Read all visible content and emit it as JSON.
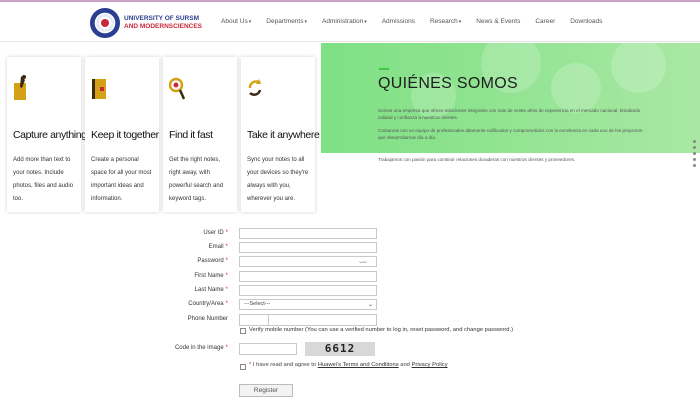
{
  "header": {
    "logo_line1": "UNIVERSITY OF SURSM",
    "logo_line2": "AND MODERNSCIENCES",
    "nav": [
      {
        "label": "About Us",
        "dropdown": true
      },
      {
        "label": "Departments",
        "dropdown": true
      },
      {
        "label": "Administration",
        "dropdown": true
      },
      {
        "label": "Admissions",
        "dropdown": false
      },
      {
        "label": "Research",
        "dropdown": true
      },
      {
        "label": "News & Events",
        "dropdown": false
      },
      {
        "label": "Career",
        "dropdown": false
      },
      {
        "label": "Downloads",
        "dropdown": false
      }
    ]
  },
  "cards": [
    {
      "icon": "pencil-icon",
      "title": "Capture anything",
      "desc": "Add more than text to your notes. Include photos, files and audio too."
    },
    {
      "icon": "notebook-icon",
      "title": "Keep it together",
      "desc": "Create a personal space for all your most important ideas and information."
    },
    {
      "icon": "magnifier-icon",
      "title": "Find it fast",
      "desc": "Get the right notes, right away, with powerful search and keyword tags."
    },
    {
      "icon": "sync-icon",
      "title": "Take it anywhere",
      "desc": "Sync your notes to all your devices so they're always with you, wherever you are."
    }
  ],
  "hero": {
    "title": "QUIÉNES SOMOS",
    "paragraphs": [
      "Somos una empresa que ofrece soluciones integrales con más de veinte años de experiencia en el mercado nacional, brindando calidad y confianza a nuestros clientes.",
      "Contamos con un equipo de profesionales altamente calificados y comprometidos con la excelencia en cada uno de los proyectos que desarrollamos día a día.",
      "Trabajamos con pasión para construir relaciones duraderas con nuestros clientes y proveedores."
    ]
  },
  "form": {
    "user_id": {
      "label": "User ID",
      "required": true,
      "value": ""
    },
    "email": {
      "label": "Email",
      "required": true,
      "value": ""
    },
    "password": {
      "label": "Password",
      "required": true,
      "value": ""
    },
    "first_name": {
      "label": "First Name",
      "required": true,
      "value": ""
    },
    "last_name": {
      "label": "Last Name",
      "required": true,
      "value": ""
    },
    "country": {
      "label": "Country/Area",
      "required": true,
      "selected": "---Select---"
    },
    "phone": {
      "label": "Phone Number",
      "required": false
    },
    "verify_text": "Verify mobile number (You can use a verified number to log in, reset password, and change password.)",
    "code": {
      "label": "Code in the image",
      "required": true,
      "captcha": "6612"
    },
    "agree": {
      "prefix": "I have read and agree to",
      "link1": "Huawei's Terms and Conditions",
      "and": "and",
      "link2": "Privacy Policy"
    },
    "register_label": "Register"
  },
  "colors": {
    "hero_green": "#8ee38f",
    "accent": "#41c741",
    "required": "#d92a2a",
    "brand_blue": "#2a3f8f",
    "brand_red": "#c8283a"
  }
}
